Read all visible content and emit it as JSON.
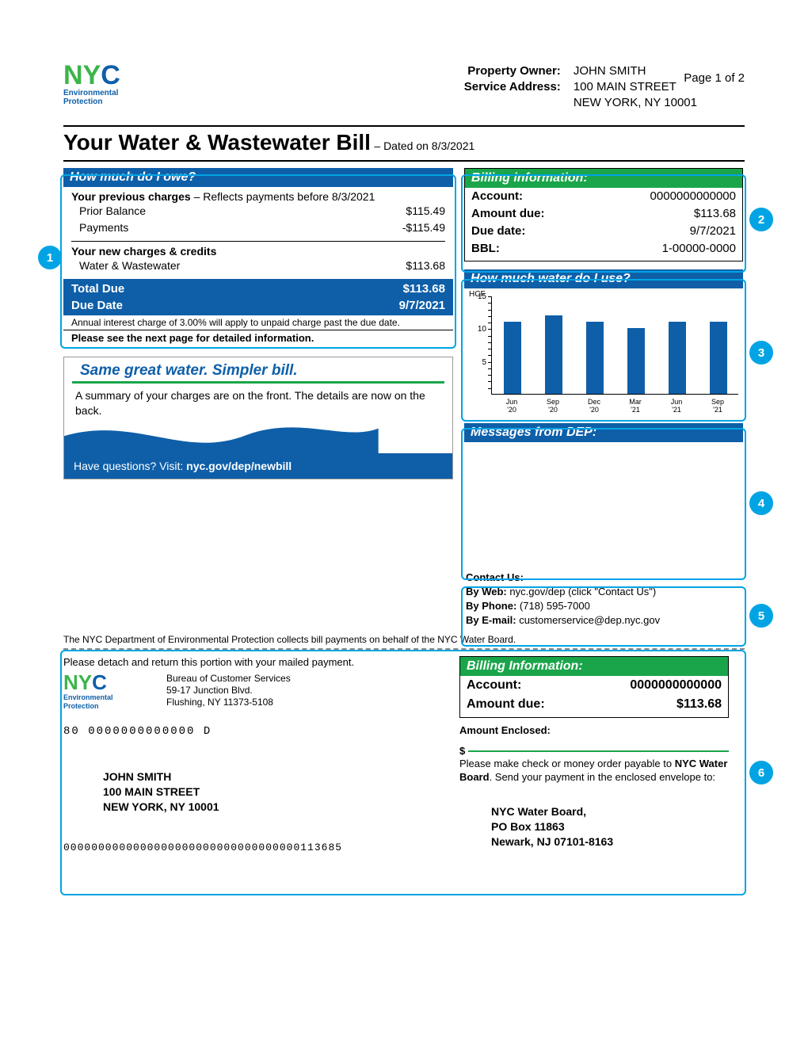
{
  "page_num": "Page 1 of 2",
  "logo": {
    "text": "NYC",
    "sub1": "Environmental",
    "sub2": "Protection"
  },
  "owner": {
    "label1": "Property Owner:",
    "label2": "Service Address:",
    "name": "JOHN SMITH",
    "addr1": "100 MAIN STREET",
    "addr2": "NEW YORK, NY 10001"
  },
  "title": {
    "main": "Your Water & Wastewater Bill",
    "dated": " – Dated on 8/3/2021"
  },
  "owe": {
    "header": "How much do I owe?",
    "prev_label": "Your previous charges",
    "prev_note": " – Reflects payments before 8/3/2021",
    "prior_label": "Prior Balance",
    "prior_val": "$115.49",
    "payments_label": "Payments",
    "payments_val": "-$115.49",
    "new_label": "Your new charges & credits",
    "line1_label": "Water & Wastewater",
    "line1_val": "$113.68",
    "total_label": "Total Due",
    "total_val": "$113.68",
    "due_label": "Due Date",
    "due_val": "9/7/2021",
    "interest": "Annual interest charge of 3.00% will apply to unpaid charge past the due date.",
    "see_next": "Please see the next page for detailed information."
  },
  "promo": {
    "title": "Same great water. Simpler bill.",
    "text": "A summary of your charges are on the front. The details are now on the back.",
    "footer_a": "Have questions? Visit: ",
    "footer_b": "nyc.gov/dep/newbill"
  },
  "billing": {
    "header": "Billing information:",
    "account_l": "Account:",
    "account_v": "0000000000000",
    "amount_l": "Amount due:",
    "amount_v": "$113.68",
    "due_l": "Due date:",
    "due_v": "9/7/2021",
    "bbl_l": "BBL:",
    "bbl_v": "1-00000-0000"
  },
  "usage": {
    "header": "How much water do I use?"
  },
  "chart_data": {
    "type": "bar",
    "ylabel": "HCF",
    "ylim": [
      0,
      15
    ],
    "yticks": [
      5,
      10,
      15
    ],
    "categories": [
      "Jun '20",
      "Sep '20",
      "Dec '20",
      "Mar '21",
      "Jun '21",
      "Sep '21"
    ],
    "values": [
      11,
      12,
      11,
      10,
      11,
      11
    ]
  },
  "messages": {
    "header": "Messages from DEP:"
  },
  "contact": {
    "title": "Contact Us:",
    "web_l": "By Web: ",
    "web_v": "nyc.gov/dep (click \"Contact Us\")",
    "phone_l": "By Phone: ",
    "phone_v": "(718) 595-7000",
    "email_l": "By E-mail: ",
    "email_v": "customerservice@dep.nyc.gov"
  },
  "stub": {
    "note_top": "The NYC Department of Environmental Protection collects bill payments on behalf of the NYC Water Board.",
    "detach": "Please detach and return this portion with your mailed payment.",
    "bureau1": "Bureau of Customer Services",
    "bureau2": "59-17 Junction Blvd.",
    "bureau3": "Flushing, NY 11373-5108",
    "ocr1": "80 0000000000000 D",
    "name": "JOHN SMITH",
    "addr1": "100 MAIN STREET",
    "addr2": "NEW YORK, NY 10001",
    "ocr2": "0000000000000000000000000000000000113685",
    "billing_header": "Billing Information:",
    "account_l": "Account:",
    "account_v": "0000000000000",
    "amount_l": "Amount due:",
    "amount_v": "$113.68",
    "enclosed_l": "Amount Enclosed:",
    "dollar": "$",
    "payable1": "Please make check or money order payable to ",
    "payable2": "NYC Water Board",
    "payable3": ". Send your payment in the enclosed envelope to:",
    "mail1": "NYC Water Board,",
    "mail2": "PO Box 11863",
    "mail3": "Newark, NJ 07101-8163"
  },
  "callouts": {
    "c1": "1",
    "c2": "2",
    "c3": "3",
    "c4": "4",
    "c5": "5",
    "c6": "6"
  }
}
